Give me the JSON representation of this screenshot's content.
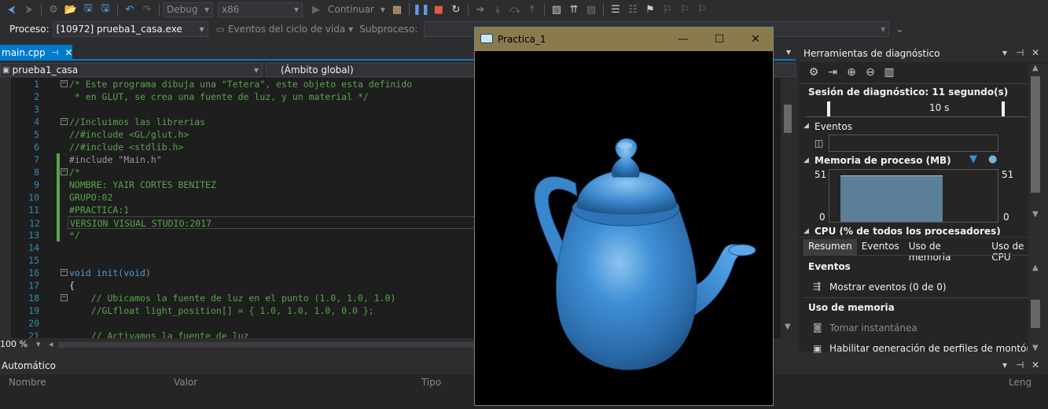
{
  "toolbar": {
    "config": "Debug",
    "platform": "x86",
    "continue_label": "Continuar"
  },
  "process_bar": {
    "process_label": "Proceso:",
    "process_value": "[10972] prueba1_casa.exe",
    "lifecycle_label": "Eventos del ciclo de vida",
    "subprocess_label": "Subproceso:"
  },
  "editor": {
    "tab_label": "main.cpp",
    "project": "prueba1_casa",
    "scope": "(Ámbito global)",
    "zoom": "100 %",
    "lines": [
      {
        "n": "1",
        "cls": "cm",
        "text": "/* Este programa dibuja una \"Tetera\", este objeto esta definido",
        "fold": "−"
      },
      {
        "n": "2",
        "cls": "cm",
        "text": " * en GLUT, se crea una fuente de luz, y un material */",
        "fold": ""
      },
      {
        "n": "3",
        "cls": "tx",
        "text": "",
        "fold": ""
      },
      {
        "n": "4",
        "cls": "cm",
        "text": "//Incluimos las librerias",
        "fold": "−"
      },
      {
        "n": "5",
        "cls": "cm",
        "text": "//#include <GL/glut.h>",
        "fold": ""
      },
      {
        "n": "6",
        "cls": "cm",
        "text": "//#include <stdlib.h>",
        "fold": ""
      },
      {
        "n": "7",
        "cls": "inc",
        "text": "#include \"Main.h\"",
        "fold": ""
      },
      {
        "n": "8",
        "cls": "cm",
        "text": "/*",
        "fold": "−"
      },
      {
        "n": "9",
        "cls": "cm",
        "text": "NOMBRE: YAIR CORTES BENITEZ",
        "fold": ""
      },
      {
        "n": "10",
        "cls": "cm",
        "text": "GRUPO:02",
        "fold": ""
      },
      {
        "n": "11",
        "cls": "cm",
        "text": "#PRACTICA:1",
        "fold": ""
      },
      {
        "n": "12",
        "cls": "cm",
        "text": "VERSION VISUAL STUDIO:2017",
        "fold": ""
      },
      {
        "n": "13",
        "cls": "cm",
        "text": "*/",
        "fold": ""
      },
      {
        "n": "14",
        "cls": "tx",
        "text": "",
        "fold": ""
      },
      {
        "n": "15",
        "cls": "tx",
        "text": "",
        "fold": ""
      },
      {
        "n": "16",
        "cls": "fn",
        "text": "void init(void)",
        "fold": "−"
      },
      {
        "n": "17",
        "cls": "tx",
        "text": "{",
        "fold": ""
      },
      {
        "n": "18",
        "cls": "cm",
        "text": "    // Ubicamos la fuente de luz en el punto (1.0, 1.0, 1.0)",
        "fold": "−"
      },
      {
        "n": "19",
        "cls": "cm",
        "text": "    //GLfloat light_position[] = { 1.0, 1.0, 1.0, 0.0 };",
        "fold": ""
      },
      {
        "n": "20",
        "cls": "tx",
        "text": "",
        "fold": ""
      },
      {
        "n": "21",
        "cls": "cm",
        "text": "    // Activamos la fuente de luz",
        "fold": ""
      }
    ]
  },
  "popup": {
    "title": "Practica_1"
  },
  "diagnostics": {
    "title": "Herramientas de diagnóstico",
    "session": "Sesión de diagnóstico: 11 segundo(s)",
    "timeline_tick": "10 s",
    "events_header": "Eventos",
    "memory_header": "Memoria de proceso (MB)",
    "mem_max_left": "51",
    "mem_min_left": "0",
    "mem_max_right": "51",
    "mem_min_right": "0",
    "memory_fill_fraction": 0.9,
    "cpu_header": "CPU (% de todos los procesadores)",
    "tabs": [
      "Resumen",
      "Eventos",
      "Uso de memoria",
      "Uso de CPU"
    ],
    "summary_events_header": "Eventos",
    "show_events": "Mostrar eventos (0 de 0)",
    "memory_usage_header": "Uso de memoria",
    "take_snapshot": "Tomar instantánea",
    "heap_profiling": "Habilitar generación de perfiles de montón (a"
  },
  "autos": {
    "title": "Automático",
    "col_name": "Nombre",
    "col_value": "Valor",
    "col_type": "Tipo",
    "col_lang": "Leng"
  },
  "colors": {
    "accent": "#007acc",
    "teapot": "#3f8fd6",
    "popup_titlebar": "#8a7b4f"
  }
}
